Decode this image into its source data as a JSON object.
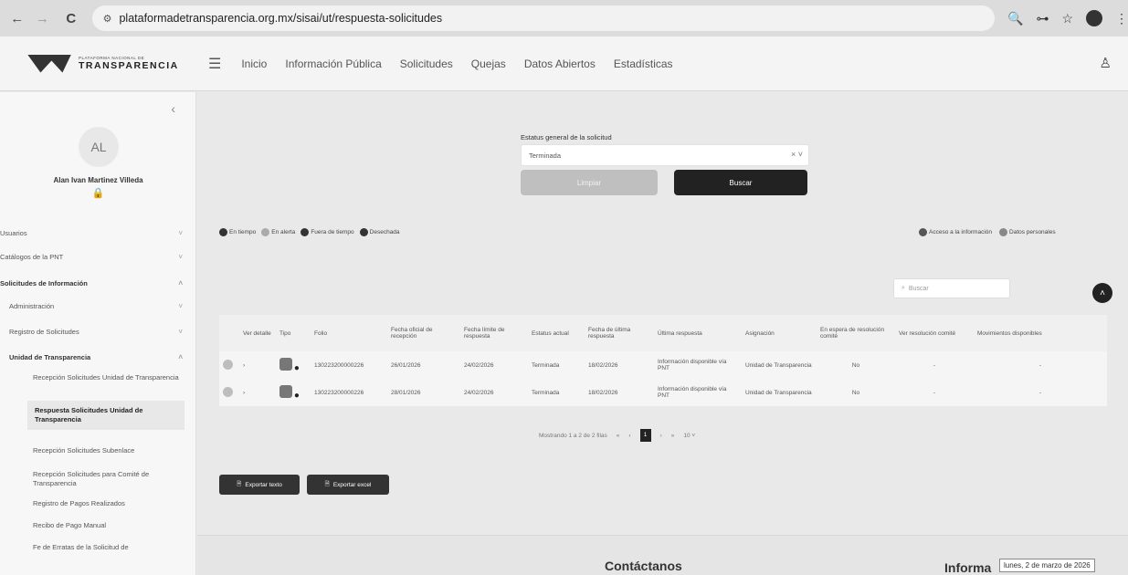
{
  "browser": {
    "url": "plataformadetransparencia.org.mx/sisai/ut/respuesta-solicitudes",
    "icons": [
      "back-icon",
      "forward-icon",
      "reload-icon",
      "site-info-icon",
      "zoom-icon",
      "password-icon",
      "bookmark-icon",
      "profile-icon",
      "more-icon"
    ]
  },
  "header": {
    "logo_small": "PLATAFORMA NACIONAL DE",
    "logo_big": "TRANSPARENCIA",
    "menu": [
      "Inicio",
      "Información Pública",
      "Solicitudes",
      "Quejas",
      "Datos Abiertos",
      "Estadísticas"
    ]
  },
  "sidebar": {
    "avatar_initials": "AL",
    "user_name": "Alan Ivan Martinez Villeda",
    "items": [
      {
        "label": "Usuarios"
      },
      {
        "label": "Catálogos de la PNT"
      },
      {
        "label": "Solicitudes de Información"
      },
      {
        "label": "Administración"
      },
      {
        "label": "Registro de Solicitudes"
      },
      {
        "label": "Unidad de Transparencia"
      },
      {
        "label": "Recepción Solicitudes Unidad de Transparencia"
      },
      {
        "label": "Respuesta Solicitudes Unidad de Transparencia"
      },
      {
        "label": "Recepción Solicitudes Subenlace"
      },
      {
        "label": "Recepción Solicitudes para Comité de Transparencia"
      },
      {
        "label": "Registro de Pagos Realizados"
      },
      {
        "label": "Recibo de Pago Manual"
      },
      {
        "label": "Fe de Erratas de la Solicitud de"
      }
    ]
  },
  "filters": {
    "status_label": "Estatus general de la solicitud",
    "status_value": "Terminada",
    "clear_label": "Limpiar",
    "search_label": "Buscar"
  },
  "legend": {
    "left": [
      {
        "label": "En tiempo",
        "color": "#333333"
      },
      {
        "label": "En alerta",
        "color": "#aaaaaa"
      },
      {
        "label": "Fuera de tiempo",
        "color": "#333333"
      },
      {
        "label": "Desechada",
        "color": "#333333"
      }
    ],
    "right": [
      {
        "label": "Acceso a la información",
        "color": "#555555"
      },
      {
        "label": "Datos personales",
        "color": "#888888"
      }
    ]
  },
  "table": {
    "search_placeholder": "Buscar",
    "headers": [
      "Ver detalle",
      "Tipo",
      "Folio",
      "Fecha oficial de recepción",
      "Fecha límite de respuesta",
      "Estatus actual",
      "Fecha de última respuesta",
      "Última respuesta",
      "Asignación",
      "En espera de resolución comité",
      "Ver resolución comité",
      "Movimientos disponibles"
    ],
    "rows": [
      {
        "folio": "130223200000226",
        "fecha_recepcion": "26/01/2026",
        "fecha_limite": "24/02/2026",
        "estatus": "Terminada",
        "fecha_ultima": "18/02/2026",
        "ultima_respuesta": "Información disponible vía PNT",
        "asignacion": "Unidad de Transparencia",
        "espera_comite": "No",
        "ver_resolucion": "-",
        "movimientos": "-"
      },
      {
        "folio": "130223200000226",
        "fecha_recepcion": "28/01/2026",
        "fecha_limite": "24/02/2026",
        "estatus": "Terminada",
        "fecha_ultima": "18/02/2026",
        "ultima_respuesta": "Información disponible vía PNT",
        "asignacion": "Unidad de Transparencia",
        "espera_comite": "No",
        "ver_resolucion": "-",
        "movimientos": "-"
      }
    ],
    "pagination": {
      "summary": "Mostrando 1 a 2 de 2 filas",
      "current_page": "1",
      "per_page": "10"
    }
  },
  "export": {
    "text_label": "Exportar texto",
    "excel_label": "Exportar excel"
  },
  "footer": {
    "contact_title": "Contáctanos",
    "info_title": "Informa",
    "date_tooltip": "lunes, 2 de marzo de 2026"
  }
}
